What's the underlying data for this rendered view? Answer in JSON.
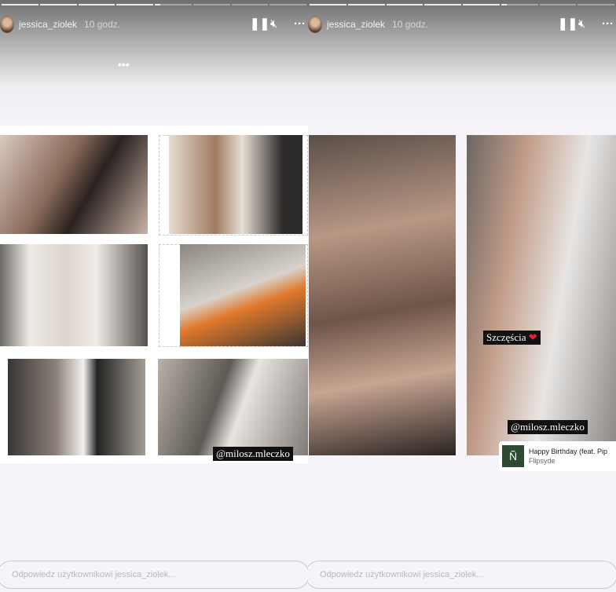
{
  "stories": [
    {
      "username": "jessica_ziolek",
      "time": "10 godz.",
      "progress_segments": 8,
      "completed_segments": 4,
      "current_segment_progress": 0.15,
      "tags": [
        "@milosz.mleczko"
      ],
      "reply_placeholder": "Odpowiedz użytkownikowi jessica_ziolek..."
    },
    {
      "username": "jessica_ziolek",
      "time": "10 godz.",
      "progress_segments": 8,
      "completed_segments": 5,
      "current_segment_progress": 0.15,
      "caption": "Szczęścia",
      "tags": [
        "@milosz.mleczko"
      ],
      "reply_placeholder": "Odpowiedz użytkownikowi jessica_ziolek...",
      "music": {
        "title": "Happy Birthday (feat. Pip",
        "artist": "Flipsyde"
      }
    }
  ],
  "icons": {
    "pause": "pause-icon",
    "mute": "muted-speaker-icon",
    "more": "more-icon",
    "heart": "heart-icon"
  }
}
